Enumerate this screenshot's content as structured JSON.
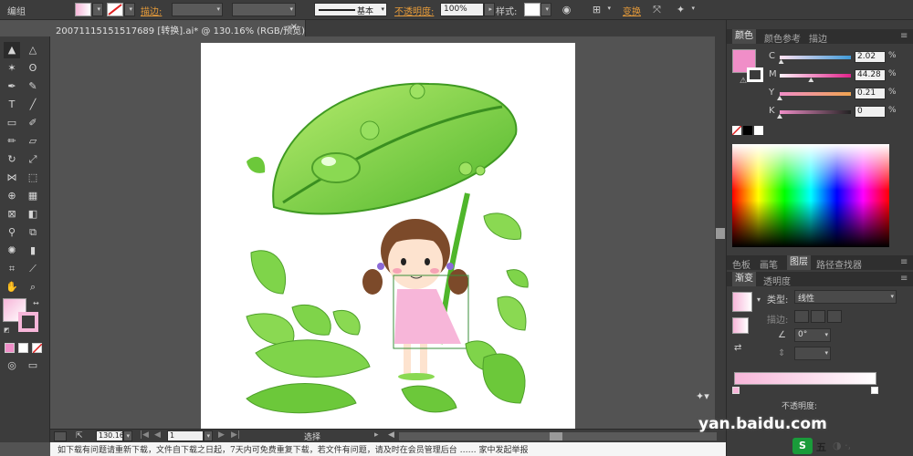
{
  "control_bar": {
    "group_label": "编组",
    "stroke_label": "描边:",
    "stroke_style": "基本",
    "opacity_label": "不透明度:",
    "opacity_value": "100%",
    "style_label": "样式:",
    "transform_label": "变换"
  },
  "document_tab": {
    "title": "20071115151517689 [转换].ai* @ 130.16% (RGB/预览)",
    "close": "×"
  },
  "status_bar": {
    "zoom": "130.16",
    "artboard_number": "1",
    "tool_label": "选择"
  },
  "color_panel": {
    "tabs": [
      "颜色",
      "颜色参考",
      "描边"
    ],
    "cmyk": [
      {
        "letter": "C",
        "value": "2.02",
        "fraction": 0.02
      },
      {
        "letter": "M",
        "value": "44.28",
        "fraction": 0.44
      },
      {
        "letter": "Y",
        "value": "0.21",
        "fraction": 0.0
      },
      {
        "letter": "K",
        "value": "0",
        "fraction": 0.0
      }
    ],
    "percent": "%",
    "fill_color": "#f08ec8"
  },
  "layers_panel": {
    "tabs": [
      "色板",
      "画笔",
      "图层",
      "路径查找器"
    ]
  },
  "gradient_panel": {
    "tabs": [
      "渐变",
      "透明度"
    ],
    "type_label": "类型:",
    "type_value": "线性",
    "stroke_label": "描边:",
    "angle_value": "0°",
    "opacity_label": "不透明度:",
    "gradient_start": "#f7b6d9",
    "gradient_end": "#ffffff"
  },
  "bottom_text": "如下载有问题请重新下载，文件自下载之日起，7天内可免费重复下载，若文件有问题，请及时在会员管理后台 …… 家中发起举报",
  "watermark": "yan.baidu.com",
  "ime_label": "五",
  "colors": {
    "ui_dark": "#3c3c3c",
    "canvas_bg": "#535353",
    "accent_orange": "#e69b3a",
    "leaf_green": "#6cc83a",
    "pink_fill": "#f08ec8"
  }
}
